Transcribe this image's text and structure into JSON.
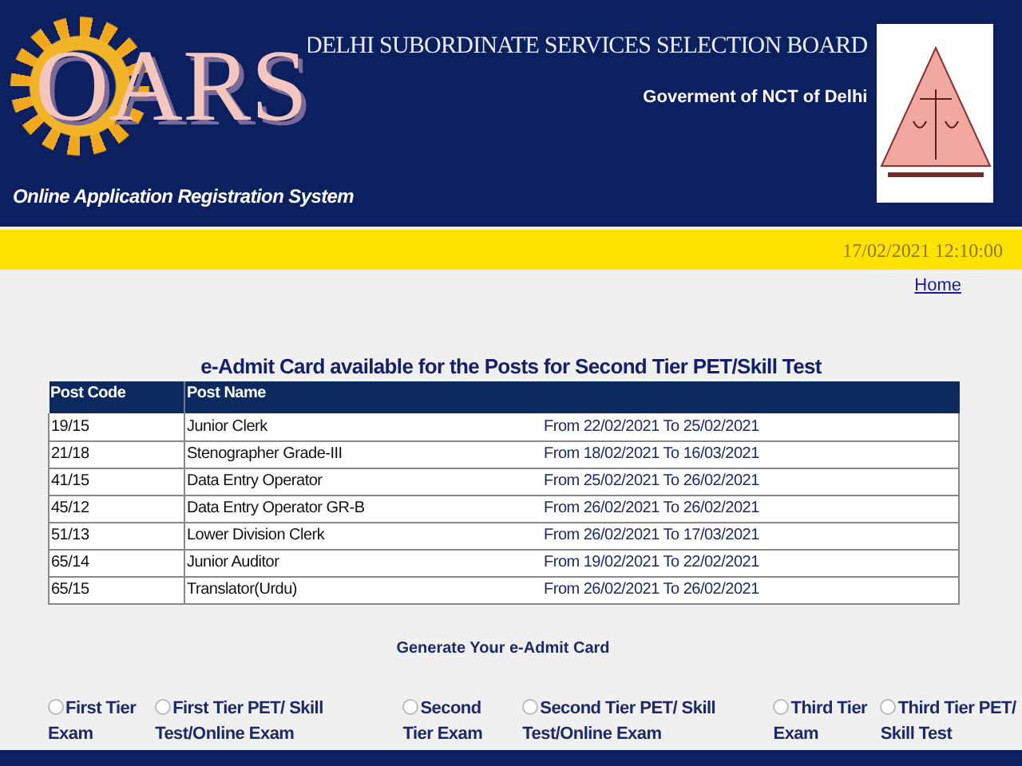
{
  "header": {
    "logo_text": "OARS",
    "tagline": "Online Application Registration System",
    "board": "DELHI SUBORDINATE SERVICES SELECTION BOARD",
    "government": "Goverment of NCT of Delhi"
  },
  "datetime": "17/02/2021 12:10:00",
  "home_link": "Home",
  "heading": "e-Admit Card available for the Posts for Second Tier PET/Skill Test",
  "table": {
    "columns": [
      "Post Code",
      "Post Name"
    ],
    "rows": [
      {
        "code": "19/15",
        "name": "Junior Clerk",
        "dates": "From 22/02/2021 To 25/02/2021"
      },
      {
        "code": "21/18",
        "name": "Stenographer Grade-III",
        "dates": "From 18/02/2021 To 16/03/2021"
      },
      {
        "code": "41/15",
        "name": "Data Entry Operator",
        "dates": "From 25/02/2021 To 26/02/2021"
      },
      {
        "code": "45/12",
        "name": "Data Entry Operator GR-B",
        "dates": "From 26/02/2021 To 26/02/2021"
      },
      {
        "code": "51/13",
        "name": "Lower Division Clerk",
        "dates": "From 26/02/2021 To 17/03/2021"
      },
      {
        "code": "65/14",
        "name": "Junior Auditor",
        "dates": "From 19/02/2021 To 22/02/2021"
      },
      {
        "code": "65/15",
        "name": "Translator(Urdu)",
        "dates": "From 26/02/2021 To 26/02/2021"
      }
    ]
  },
  "generate_label": "Generate Your e-Admit Card",
  "options": [
    {
      "label": "First Tier Exam",
      "selected": false
    },
    {
      "label": "First Tier PET/ Skill Test/Online Exam",
      "selected": false
    },
    {
      "label": "Second Tier Exam",
      "selected": false
    },
    {
      "label": "Second Tier PET/ Skill Test/Online Exam",
      "selected": false
    },
    {
      "label": "Third Tier Exam",
      "selected": false
    },
    {
      "label": "Third Tier PET/ Skill Test",
      "selected": false
    }
  ]
}
